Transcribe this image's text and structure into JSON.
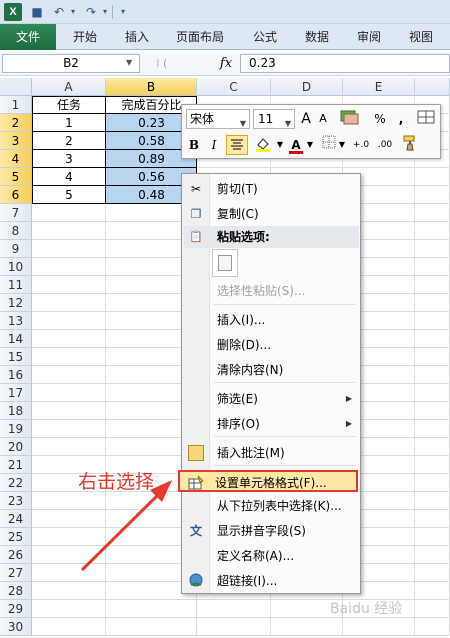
{
  "titlebar": {
    "logo_letter": "X",
    "icons": [
      "save-icon",
      "undo-icon",
      "redo-icon",
      "customize-icon"
    ],
    "undo_glyph": "↶",
    "redo_glyph": "↷",
    "save_glyph": "■",
    "more_glyph": "▾"
  },
  "ribbon": {
    "tabs": [
      {
        "label": "文件"
      },
      {
        "label": "开始"
      },
      {
        "label": "插入"
      },
      {
        "label": "页面布局"
      },
      {
        "label": "公式"
      },
      {
        "label": "数据"
      },
      {
        "label": "审阅"
      },
      {
        "label": "视图"
      }
    ]
  },
  "formula_bar": {
    "name_box": "B2",
    "fx": "fx",
    "value": "0.23"
  },
  "sheet": {
    "columns": [
      "A",
      "B",
      "C",
      "D",
      "E"
    ],
    "selected_column": "B",
    "rows": [
      "1",
      "2",
      "3",
      "4",
      "5",
      "6",
      "7",
      "8",
      "9",
      "10",
      "11",
      "12",
      "13",
      "14",
      "15",
      "16",
      "17",
      "18",
      "19",
      "20",
      "21",
      "22",
      "23",
      "24",
      "25",
      "26",
      "27",
      "28",
      "29",
      "30"
    ],
    "header_row": {
      "a": "任务",
      "b": "完成百分比"
    },
    "data_rows": [
      {
        "task": "1",
        "pct": "0.23"
      },
      {
        "task": "2",
        "pct": "0.58"
      },
      {
        "task": "3",
        "pct": "0.89"
      },
      {
        "task": "4",
        "pct": "0.56"
      },
      {
        "task": "5",
        "pct": "0.48"
      }
    ]
  },
  "mini_toolbar": {
    "font": "宋体",
    "size": "11",
    "grow": "A",
    "shrink": "A",
    "percent": "%",
    "comma": ",",
    "bold": "B",
    "italic": "I",
    "font_color": "A",
    "dec_inc": "+.0",
    "dec_dec": ".00"
  },
  "context_menu": {
    "items": [
      {
        "label": "剪切(T)",
        "icon": "scissors-icon",
        "glyph": "✂"
      },
      {
        "label": "复制(C)",
        "icon": "copy-icon",
        "glyph": "❐"
      },
      {
        "label": "粘贴选项:",
        "icon": "paste-icon",
        "glyph": "📋"
      },
      {
        "label": "选择性粘贴(S)..."
      },
      {
        "label": "插入(I)..."
      },
      {
        "label": "删除(D)..."
      },
      {
        "label": "清除内容(N)"
      },
      {
        "label": "筛选(E)"
      },
      {
        "label": "排序(O)"
      },
      {
        "label": "插入批注(M)",
        "icon": "comment-icon",
        "glyph": "▭"
      },
      {
        "label": "设置单元格格式(F)...",
        "icon": "format-cells-icon",
        "glyph": "▦"
      },
      {
        "label": "从下拉列表中选择(K)..."
      },
      {
        "label": "显示拼音字段(S)",
        "icon": "phonetic-icon",
        "glyph": "文"
      },
      {
        "label": "定义名称(A)..."
      },
      {
        "label": "超链接(I)...",
        "icon": "hyperlink-icon",
        "glyph": "🌐"
      }
    ],
    "submenu_arrow": "▶"
  },
  "annotation": {
    "text": "右击选择",
    "color": "#e53a2b"
  },
  "watermark": "Baidu 经验"
}
